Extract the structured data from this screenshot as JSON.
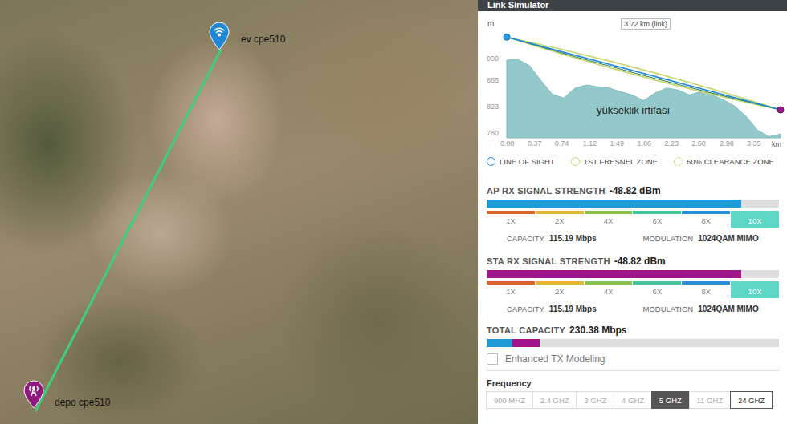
{
  "sites": [
    {
      "name": "ev cpe510",
      "kind": "station",
      "color": "#1e88d6"
    },
    {
      "name": "depo cpe510",
      "kind": "ap",
      "color": "#8e1a7e"
    }
  ],
  "panel": {
    "title": "Link Simulator",
    "profile": {
      "unit": "m",
      "link_label": "3.72 km (link)",
      "annotation": "yükseklik irtifası",
      "y_ticks": [
        "900",
        "866",
        "823",
        "780"
      ],
      "x_ticks": [
        "0.00",
        "0.37",
        "0.74",
        "1.12",
        "1.49",
        "1.86",
        "2.23",
        "2.60",
        "2.98",
        "3.35"
      ],
      "x_unit": "km",
      "distance_km": 3.72,
      "terrain_m": [
        899,
        900,
        890,
        866,
        844,
        838,
        854,
        859,
        856,
        854,
        848,
        843,
        834,
        846,
        854,
        851,
        843,
        848,
        843,
        835,
        825,
        808,
        786,
        776,
        780
      ],
      "line_of_sight_m": [
        936,
        819
      ]
    },
    "legend": [
      {
        "label": "LINE OF SIGHT",
        "kind": "solid",
        "color": "#1e88d6"
      },
      {
        "label": "1ST FRESNEL ZONE",
        "kind": "solid",
        "color": "#c5d86d"
      },
      {
        "label": "60% CLEARANCE ZONE",
        "kind": "dashed",
        "color": "#c5d86d"
      }
    ],
    "signals": [
      {
        "title": "AP RX SIGNAL STRENGTH",
        "value": "-48.82 dBm",
        "level": 0.87,
        "color": "#1e9ad6",
        "rates": [
          {
            "label": "1X",
            "color": "#d9622b",
            "selected": false
          },
          {
            "label": "2X",
            "color": "#e3b530",
            "selected": false
          },
          {
            "label": "4X",
            "color": "#8bc34a",
            "selected": false
          },
          {
            "label": "6X",
            "color": "#45c39c",
            "selected": false
          },
          {
            "label": "8X",
            "color": "#2a8fd4",
            "selected": false
          },
          {
            "label": "10X",
            "color": "#5dd6c6",
            "selected": true
          }
        ],
        "capacity_label": "CAPACITY",
        "capacity": "115.19 Mbps",
        "modulation_label": "MODULATION",
        "modulation": "1024QAM MIMO"
      },
      {
        "title": "STA RX SIGNAL STRENGTH",
        "value": "-48.82 dBm",
        "level": 0.87,
        "color": "#a0148c",
        "rates": [
          {
            "label": "1X",
            "color": "#d9622b",
            "selected": false
          },
          {
            "label": "2X",
            "color": "#e3b530",
            "selected": false
          },
          {
            "label": "4X",
            "color": "#8bc34a",
            "selected": false
          },
          {
            "label": "6X",
            "color": "#45c39c",
            "selected": false
          },
          {
            "label": "8X",
            "color": "#2a8fd4",
            "selected": false
          },
          {
            "label": "10X",
            "color": "#5dd6c6",
            "selected": true
          }
        ],
        "capacity_label": "CAPACITY",
        "capacity": "115.19 Mbps",
        "modulation_label": "MODULATION",
        "modulation": "1024QAM MIMO"
      }
    ],
    "total": {
      "title": "TOTAL CAPACITY",
      "value": "230.38 Mbps",
      "segments": [
        {
          "level": 0.088,
          "color": "#1e9ad6"
        },
        {
          "level": 0.092,
          "color": "#a0148c"
        }
      ]
    },
    "enhanced_tx": {
      "label": "Enhanced TX Modeling",
      "checked": false
    },
    "frequency": {
      "title": "Frequency",
      "options": [
        {
          "label": "900 MHZ",
          "selected": false,
          "disabled": true
        },
        {
          "label": "2.4 GHZ",
          "selected": false,
          "disabled": true
        },
        {
          "label": "3 GHZ",
          "selected": false,
          "disabled": true
        },
        {
          "label": "4 GHZ",
          "selected": false,
          "disabled": true
        },
        {
          "label": "5 GHZ",
          "selected": true,
          "disabled": false
        },
        {
          "label": "11 GHZ",
          "selected": false,
          "disabled": true
        },
        {
          "label": "24 GHZ",
          "selected": false,
          "disabled": false
        }
      ]
    }
  }
}
